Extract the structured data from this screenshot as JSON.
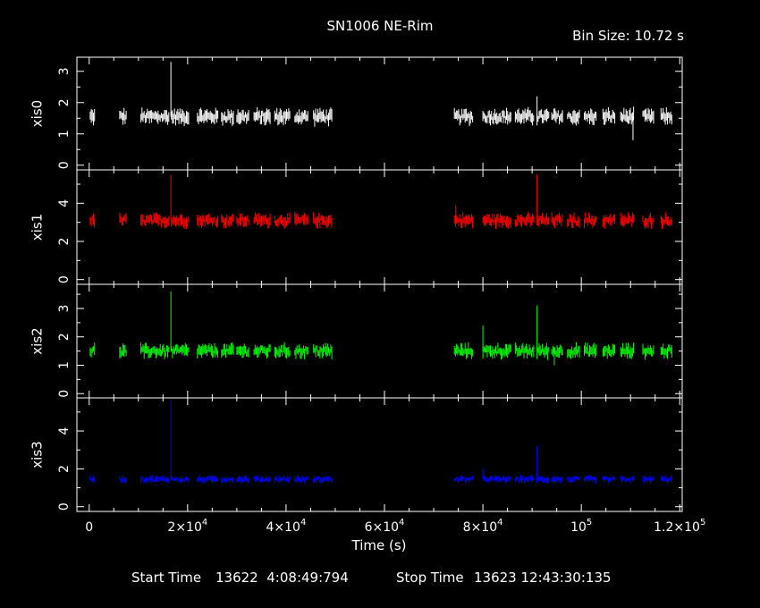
{
  "chart_data": {
    "type": "line",
    "title": "SN1006 NE-Rim",
    "bin_size": "Bin Size: 10.72 s",
    "xlabel": "Time (s)",
    "xlim": [
      -2500,
      120500
    ],
    "x_ticks": [
      {
        "value": 0,
        "label": "0",
        "exp": ""
      },
      {
        "value": 20000,
        "label": "2×10",
        "exp": "4"
      },
      {
        "value": 40000,
        "label": "4×10",
        "exp": "4"
      },
      {
        "value": 60000,
        "label": "6×10",
        "exp": "4"
      },
      {
        "value": 80000,
        "label": "8×10",
        "exp": "4"
      },
      {
        "value": 100000,
        "label": "10",
        "exp": "5"
      },
      {
        "value": 120000,
        "label": "1.2×10",
        "exp": "5"
      }
    ],
    "good_intervals": [
      [
        200,
        1200
      ],
      [
        6200,
        7700
      ],
      [
        10500,
        16300
      ],
      [
        16700,
        20300
      ],
      [
        22000,
        26200
      ],
      [
        26900,
        29300
      ],
      [
        30000,
        32500
      ],
      [
        33500,
        36800
      ],
      [
        37700,
        40800
      ],
      [
        41800,
        44500
      ],
      [
        45600,
        49500
      ],
      [
        74200,
        78000
      ],
      [
        80000,
        85800
      ],
      [
        86600,
        90500
      ],
      [
        91000,
        93500
      ],
      [
        94000,
        96300
      ],
      [
        97200,
        99700
      ],
      [
        100600,
        103000
      ],
      [
        104400,
        106900
      ],
      [
        108000,
        110800
      ],
      [
        112500,
        114800
      ],
      [
        116200,
        118500
      ]
    ],
    "series": [
      {
        "name": "xis0",
        "color": "#ffffff",
        "ylim": [
          -0.15,
          3.45
        ],
        "yticks": [
          0,
          1,
          2,
          3
        ],
        "level": 1.55,
        "noise": 0.22,
        "spikes": [
          [
            16600,
            3.3
          ],
          [
            91000,
            2.2
          ],
          [
            110500,
            0.8
          ]
        ]
      },
      {
        "name": "xis1",
        "color": "#ff0000",
        "ylim": [
          -0.25,
          5.75
        ],
        "yticks": [
          0,
          2,
          4
        ],
        "level": 3.1,
        "noise": 0.32,
        "spikes": [
          [
            16600,
            5.5
          ],
          [
            91000,
            5.5
          ],
          [
            74500,
            3.9
          ]
        ]
      },
      {
        "name": "xis2",
        "color": "#00ff00",
        "ylim": [
          -0.15,
          3.85
        ],
        "yticks": [
          0,
          1,
          2,
          3
        ],
        "level": 1.5,
        "noise": 0.22,
        "spikes": [
          [
            16600,
            3.6
          ],
          [
            91000,
            3.1
          ],
          [
            80000,
            2.4
          ],
          [
            94500,
            1.0
          ]
        ]
      },
      {
        "name": "xis3",
        "color": "#0000ff",
        "ylim": [
          -0.25,
          5.75
        ],
        "yticks": [
          0,
          2,
          4
        ],
        "level": 1.45,
        "noise": 0.16,
        "spikes": [
          [
            16600,
            5.6
          ],
          [
            91000,
            3.2
          ],
          [
            80000,
            2.0
          ]
        ]
      }
    ]
  },
  "footer": {
    "start_label": "Start Time",
    "start_value": "13622  4:08:49:794",
    "stop_label": "Stop Time",
    "stop_value": "13623 12:43:30:135"
  }
}
